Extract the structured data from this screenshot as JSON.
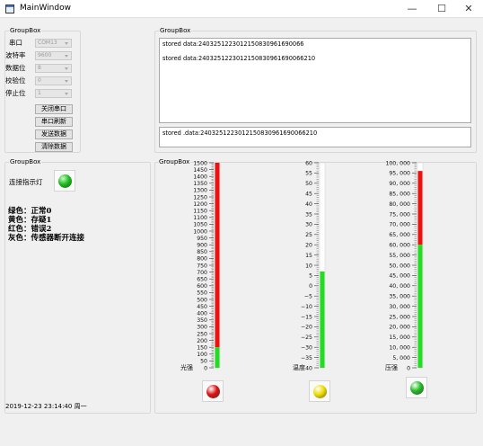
{
  "window": {
    "title": "MainWindow",
    "minimize": "—",
    "maximize": "☐",
    "close": "✕"
  },
  "serial": {
    "group_title": "GroupBox",
    "fields": [
      {
        "label": "串口",
        "value": "COM13"
      },
      {
        "label": "波特率",
        "value": "9600"
      },
      {
        "label": "数据位",
        "value": "8"
      },
      {
        "label": "校验位",
        "value": "0"
      },
      {
        "label": "停止位",
        "value": "1"
      }
    ],
    "buttons": [
      "关闭串口",
      "串口刷新",
      "发送数据",
      "清除数据"
    ]
  },
  "log": {
    "group_title": "GroupBox",
    "received": [
      "stored data:2403251223012150830961690066",
      "stored data:2403251223012150830961690066210"
    ],
    "send_text": "stored .data:2403251223012150830961690066210"
  },
  "status": {
    "group_title": "GroupBox",
    "indicator_label": "连接指示灯",
    "indicator_color": "#22bb22",
    "legend": [
      "绿色：正常0",
      "黄色：存疑1",
      "红色：错误2",
      "灰色：传感器断开连接"
    ],
    "datetime": "2019-12-23 23:14:40",
    "weekday": "周一"
  },
  "gauges": {
    "group_title": "GroupBox",
    "items": [
      {
        "name": "光强",
        "min": 0,
        "max": 1500,
        "step": 50,
        "value": 1500,
        "safe_limit": 150,
        "fill_top_color": "#ee1111",
        "fill_bottom_color": "#22dd22",
        "led_color": "#dd1111"
      },
      {
        "name": "温度",
        "min": -40,
        "max": 60,
        "step": 5,
        "value": 7,
        "safe_limit": 7,
        "fill_top_color": "#ee1111",
        "fill_bottom_color": "#22dd22",
        "led_color": "#eedd00"
      },
      {
        "name": "压强",
        "min": 0,
        "max": 100000,
        "step": 5000,
        "value": 96000,
        "safe_limit": 60000,
        "fill_top_color": "#ee1111",
        "fill_bottom_color": "#22dd22",
        "led_color": "#22bb22"
      }
    ]
  }
}
